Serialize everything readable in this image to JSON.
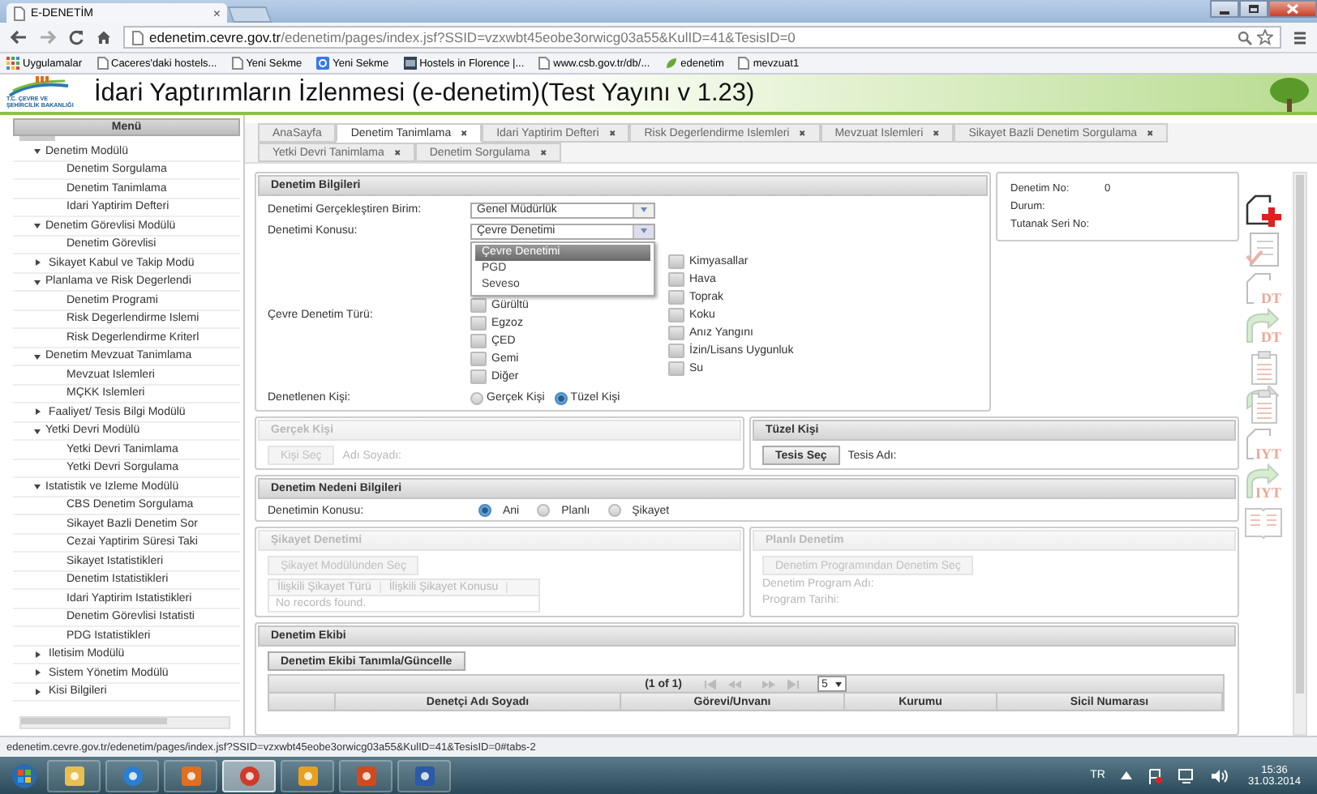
{
  "browser": {
    "tab": {
      "title": "E-DENETİM",
      "close": "×"
    },
    "url_host": "edenetim.cevre.gov.tr",
    "url_path": "/edenetim/pages/index.jsf?SSID=vzxwbt45eobe3orwicg03a55&KulID=41&TesisID=0",
    "bookmarks": [
      {
        "kind": "apps",
        "label": "Uygulamalar"
      },
      {
        "kind": "page",
        "label": "Caceres'daki hostels..."
      },
      {
        "kind": "page",
        "label": "Yeni Sekme"
      },
      {
        "kind": "google",
        "label": "Yeni Sekme"
      },
      {
        "kind": "hostel",
        "label": "Hostels in Florence |..."
      },
      {
        "kind": "page",
        "label": "www.csb.gov.tr/db/..."
      },
      {
        "kind": "leaf",
        "label": "edenetim"
      },
      {
        "kind": "page",
        "label": "mevzuat1"
      }
    ]
  },
  "header": {
    "logo_text": "T.C. ÇEVRE VE ŞEHİRCİLİK BAKANLIĞI",
    "title": "İdari Yaptırımların İzlenmesi (e-denetim)(Test Yayını v 1.23)"
  },
  "sidebar": {
    "title": "Menü",
    "items": [
      {
        "label": "Denetim Modülü",
        "expanded": true,
        "children": [
          {
            "label": "Denetim Sorgulama"
          },
          {
            "label": "Denetim Tanimlama"
          },
          {
            "label": "Idari Yaptirim Defteri"
          }
        ]
      },
      {
        "label": "Denetim Görevlisi Modülü",
        "expanded": true,
        "children": [
          {
            "label": "Denetim Görevlisi"
          }
        ]
      },
      {
        "label": "Sikayet Kabul ve Takip Modü",
        "expanded": false
      },
      {
        "label": "Planlama ve Risk Degerlendi",
        "expanded": true,
        "children": [
          {
            "label": "Denetim Programi"
          },
          {
            "label": "Risk Degerlendirme Islemi"
          },
          {
            "label": "Risk Degerlendirme Kriterl"
          }
        ]
      },
      {
        "label": "Denetim Mevzuat Tanimlama",
        "expanded": true,
        "children": [
          {
            "label": "Mevzuat Islemleri"
          },
          {
            "label": "MÇKK Islemleri"
          }
        ]
      },
      {
        "label": "Faaliyet/ Tesis Bilgi Modülü",
        "expanded": false
      },
      {
        "label": "Yetki Devri Modülü",
        "expanded": true,
        "children": [
          {
            "label": "Yetki Devri Tanimlama"
          },
          {
            "label": "Yetki Devri Sorgulama"
          }
        ]
      },
      {
        "label": "Istatistik ve Izleme Modülü",
        "expanded": true,
        "children": [
          {
            "label": "CBS Denetim Sorgulama"
          },
          {
            "label": "Sikayet Bazli Denetim Sor"
          },
          {
            "label": "Cezai Yaptirim Süresi Taki"
          },
          {
            "label": "Sikayet Istatistikleri"
          },
          {
            "label": "Denetim Istatistikleri"
          },
          {
            "label": "Idari Yaptirim Istatistikleri"
          },
          {
            "label": "Denetim Görevlisi Istatisti"
          },
          {
            "label": "PDG Istatistikleri"
          }
        ]
      },
      {
        "label": "Iletisim Modülü",
        "expanded": false
      },
      {
        "label": "Sistem Yönetim Modülü",
        "expanded": false
      },
      {
        "label": "Kisi Bilgileri",
        "expanded": false
      }
    ]
  },
  "tab_rows": [
    [
      {
        "label": "AnaSayfa",
        "selected": false
      },
      {
        "label": "Denetim Tanimlama",
        "close": "✖",
        "selected": true
      },
      {
        "label": "Idari Yaptirim Defteri",
        "close": "✖",
        "selected": false
      },
      {
        "label": "Risk Degerlendirme Islemleri",
        "close": "✖",
        "selected": false
      },
      {
        "label": "Mevzuat Islemleri",
        "close": "✖",
        "selected": false
      },
      {
        "label": "Sikayet Bazli Denetim Sorgulama",
        "close": "✖",
        "selected": false
      }
    ],
    [
      {
        "label": "Yetki Devri Tanimlama",
        "close": "✖",
        "selected": false
      },
      {
        "label": "Denetim Sorgulama",
        "close": "✖",
        "selected": false
      }
    ]
  ],
  "inspection_info": {
    "title": "Denetim Bilgileri",
    "fields": [
      {
        "label": "Denetimi Gerçekleştiren Birim:",
        "value": "Genel Müdürlük",
        "expanded": false
      },
      {
        "label": "Denetimi Konusu:",
        "value": "Çevre Denetimi",
        "expanded": true,
        "options": [
          {
            "label": "Çevre Denetimi",
            "selected": true
          },
          {
            "label": "PGD",
            "selected": false
          },
          {
            "label": "Seveso",
            "selected": false
          }
        ]
      }
    ],
    "type_label": "Çevre Denetim Türü:",
    "types_left": [
      {
        "label": "Gürültü",
        "checked": false
      },
      {
        "label": "Egzoz",
        "checked": false
      },
      {
        "label": "ÇED",
        "checked": false
      },
      {
        "label": "Gemi",
        "checked": false
      },
      {
        "label": "Diğer",
        "checked": false
      }
    ],
    "types_right": [
      {
        "label": "Kimyasallar",
        "checked": false
      },
      {
        "label": "Hava",
        "checked": false
      },
      {
        "label": "Toprak",
        "checked": false
      },
      {
        "label": "Koku",
        "checked": false
      },
      {
        "label": "Anız Yangını",
        "checked": false
      },
      {
        "label": "İzin/Lisans Uygunluk",
        "checked": false
      },
      {
        "label": "Su",
        "checked": false
      }
    ],
    "person_label": "Denetlenen Kişi:",
    "person_options": [
      {
        "label": "Gerçek Kişi",
        "selected": false
      },
      {
        "label": "Tüzel Kişi",
        "selected": true
      }
    ]
  },
  "summary": [
    {
      "label": "Denetim No:",
      "value": "0"
    },
    {
      "label": "Durum:"
    },
    {
      "label": "Tutanak Seri No:"
    }
  ],
  "toolbar": [
    {
      "kind": "new",
      "disabled": false
    },
    {
      "kind": "check",
      "disabled": true
    },
    {
      "kind": "doc",
      "label": "DT",
      "disabled": true
    },
    {
      "kind": "arrow-doc",
      "label": "DT",
      "disabled": true
    },
    {
      "kind": "clipboard",
      "disabled": true
    },
    {
      "kind": "arrow-clipboard",
      "disabled": true
    },
    {
      "kind": "doc",
      "label": "IYT",
      "disabled": true
    },
    {
      "kind": "arrow-doc",
      "label": "IYT",
      "disabled": true
    },
    {
      "kind": "book",
      "disabled": true
    }
  ],
  "person_panels": [
    {
      "title": "Gerçek Kişi",
      "disabled": true,
      "button": "Kişi Seç",
      "field_label": "Adı Soyadı:"
    },
    {
      "title": "Tüzel Kişi",
      "disabled": false,
      "button": "Tesis Seç",
      "field_label": "Tesis Adı:"
    }
  ],
  "reason": {
    "title": "Denetim Nedeni Bilgileri",
    "label": "Denetimin Konusu:",
    "options": [
      {
        "label": "Ani",
        "selected": true
      },
      {
        "label": "Planlı",
        "selected": false
      },
      {
        "label": "Şikayet",
        "selected": false
      }
    ]
  },
  "complaint": {
    "title": "Şikayet Denetimi",
    "disabled": true,
    "button": "Şikayet Modülünden Seç",
    "columns": [
      "İlişkili Şikayet Türü",
      "İlişkili Şikayet Konusu"
    ],
    "empty": "No records found."
  },
  "planned": {
    "title": "Planlı Denetim",
    "disabled": true,
    "button": "Denetim Programından Denetim Seç",
    "fields": [
      "Denetim Program Adı:",
      "Program Tarihi:"
    ]
  },
  "team": {
    "title": "Denetim Ekibi",
    "button": "Denetim Ekibi Tanımla/Güncelle",
    "page_report": "(1 of 1)",
    "rows_per_page": "5",
    "columns": [
      "Denetçi Adı Soyadı",
      "Görevi/Unvanı",
      "Kurumu",
      "Sicil Numarası"
    ]
  },
  "status_url": "edenetim.cevre.gov.tr/edenetim/pages/index.jsf?SSID=vzxwbt45eobe3orwicg03a55&KulID=41&TesisID=0#tabs-2",
  "taskbar": {
    "apps": [
      {
        "kind": "explorer",
        "selected": false
      },
      {
        "kind": "ie",
        "selected": false
      },
      {
        "kind": "media",
        "selected": false
      },
      {
        "kind": "chrome",
        "selected": true
      },
      {
        "kind": "outlook",
        "selected": false
      },
      {
        "kind": "powerpoint",
        "selected": false
      },
      {
        "kind": "word",
        "selected": false
      }
    ],
    "language": "TR",
    "time": "15:36",
    "date": "31.03.2014"
  }
}
